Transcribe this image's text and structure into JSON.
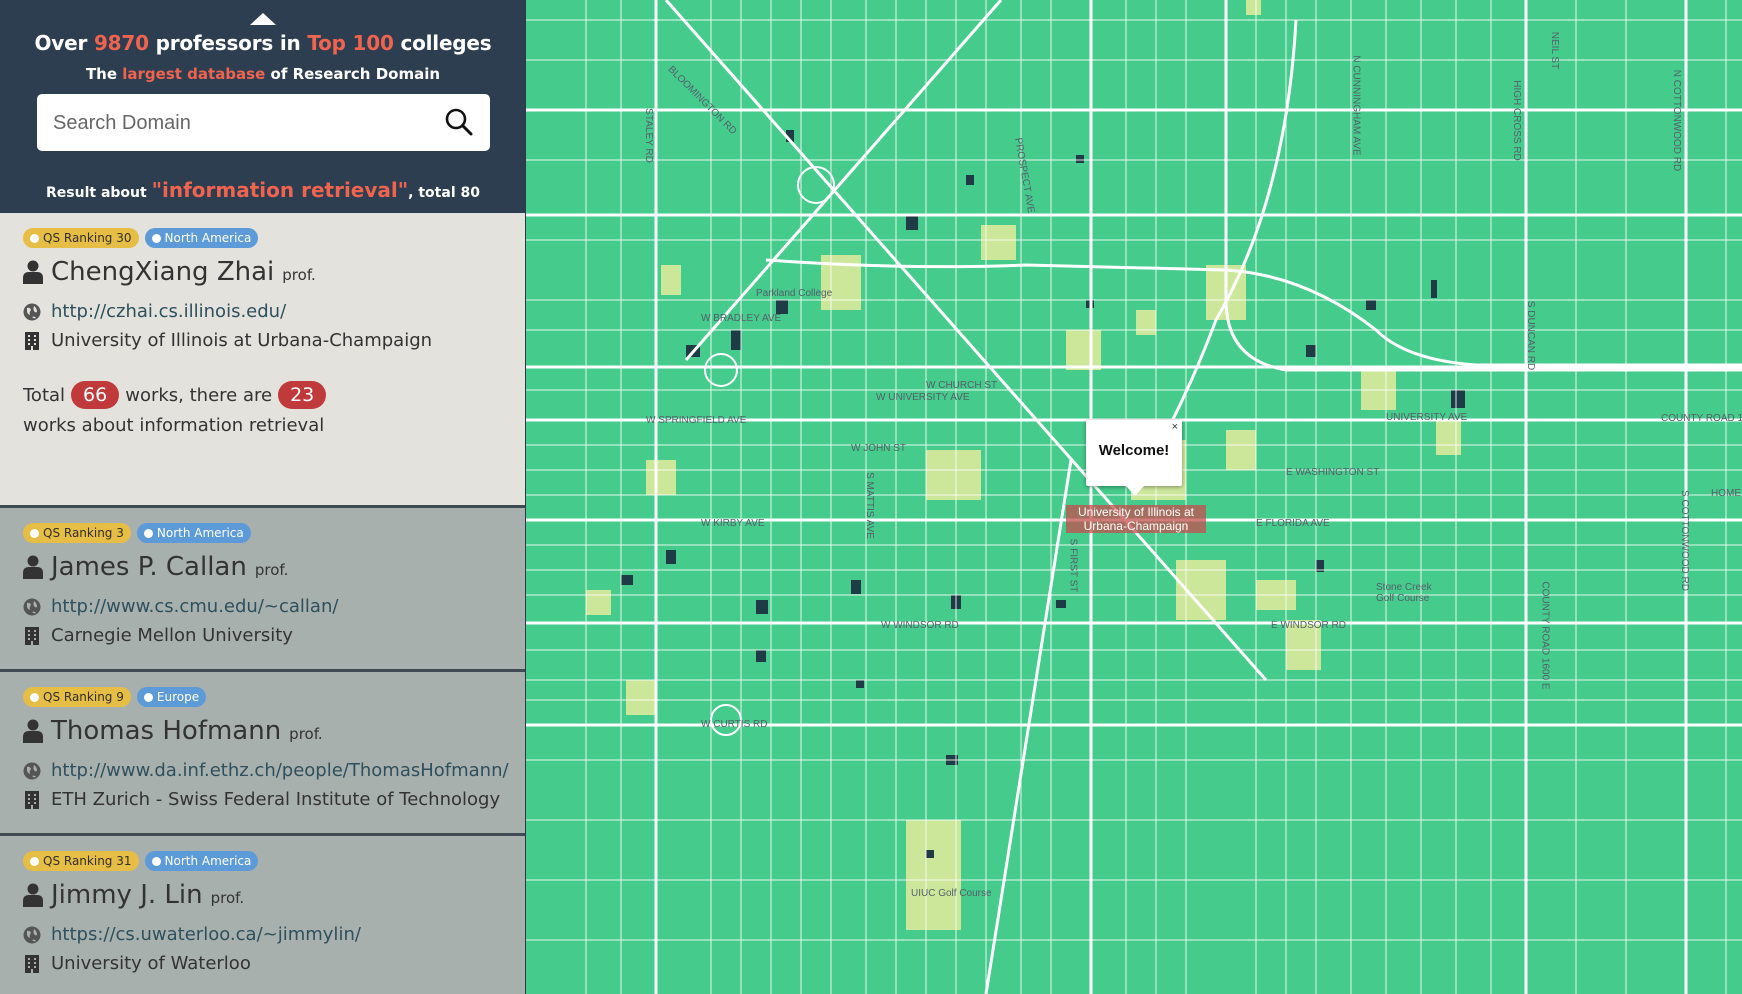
{
  "header": {
    "headline_pre": "Over",
    "professor_count": "9870",
    "headline_mid": "professors in",
    "top_colleges": "Top 100",
    "headline_post": "colleges",
    "sub_pre": "The",
    "sub_highlight": "largest database",
    "sub_post": "of Research Domain",
    "result_pre": "Result about",
    "result_query": "\"information retrieval\"",
    "result_post": ", total 80"
  },
  "search": {
    "placeholder": "Search Domain",
    "value": ""
  },
  "professors": [
    {
      "qs_ranking": "QS Ranking 30",
      "region": "North America",
      "name": "ChengXiang Zhai",
      "title": "prof.",
      "homepage": "http://czhai.cs.illinois.edu/",
      "institution": "University of Illinois at Urbana-Champaign",
      "works_pre": "Total",
      "total_works": "66",
      "works_mid": "works,  there are",
      "domain_works": "23",
      "works_post": "works about information retrieval"
    },
    {
      "qs_ranking": "QS Ranking 3",
      "region": "North America",
      "name": "James P. Callan",
      "title": "prof.",
      "homepage": "http://www.cs.cmu.edu/~callan/",
      "institution": "Carnegie Mellon University"
    },
    {
      "qs_ranking": "QS Ranking 9",
      "region": "Europe",
      "name": "Thomas Hofmann",
      "title": "prof.",
      "homepage": "http://www.da.inf.ethz.ch/people/ThomasHofmann/",
      "institution": "ETH Zurich - Swiss Federal Institute of Technology"
    },
    {
      "qs_ranking": "QS Ranking 31",
      "region": "North America",
      "name": "Jimmy J. Lin",
      "title": "prof.",
      "homepage": "https://cs.uwaterloo.ca/~jimmylin/",
      "institution": "University of Waterloo"
    }
  ],
  "map": {
    "popup_text": "Welcome!",
    "popup_close": "×",
    "marker_label": "University of Illinois at Urbana-Champaign",
    "colors": {
      "land": "#45cb8c",
      "road": "#ffffff",
      "park": "#cde79a",
      "water": "#1f3b46"
    },
    "street_labels": [
      "BLOOMINGTON RD",
      "STALEY RD",
      "W BRADLEY AVE",
      "Parkland College",
      "W UNIVERSITY AVE",
      "W CHURCH ST",
      "W SPRINGFIELD AVE",
      "W JOHN ST",
      "W KIRBY AVE",
      "W WINDSOR RD",
      "W CURTIS RD",
      "UIUC Golf Course",
      "E WASHINGTON ST",
      "E FLORIDA AVE",
      "E WINDSOR RD",
      "Stone Creek Golf Course",
      "UNIVERSITY AVE",
      "COUNTY ROAD 1700 E",
      "N CUNNINGHAM AVE",
      "HIGH CROSS RD",
      "N COTTONWOOD RD",
      "S COTTONWOOD RD",
      "COUNTY ROAD 1600 E",
      "S DUNCAN RD",
      "PROSPECT AVE",
      "NEIL ST",
      "S MATTIS AVE",
      "S FIRST ST",
      "S PHILO RD",
      "HOME"
    ]
  }
}
